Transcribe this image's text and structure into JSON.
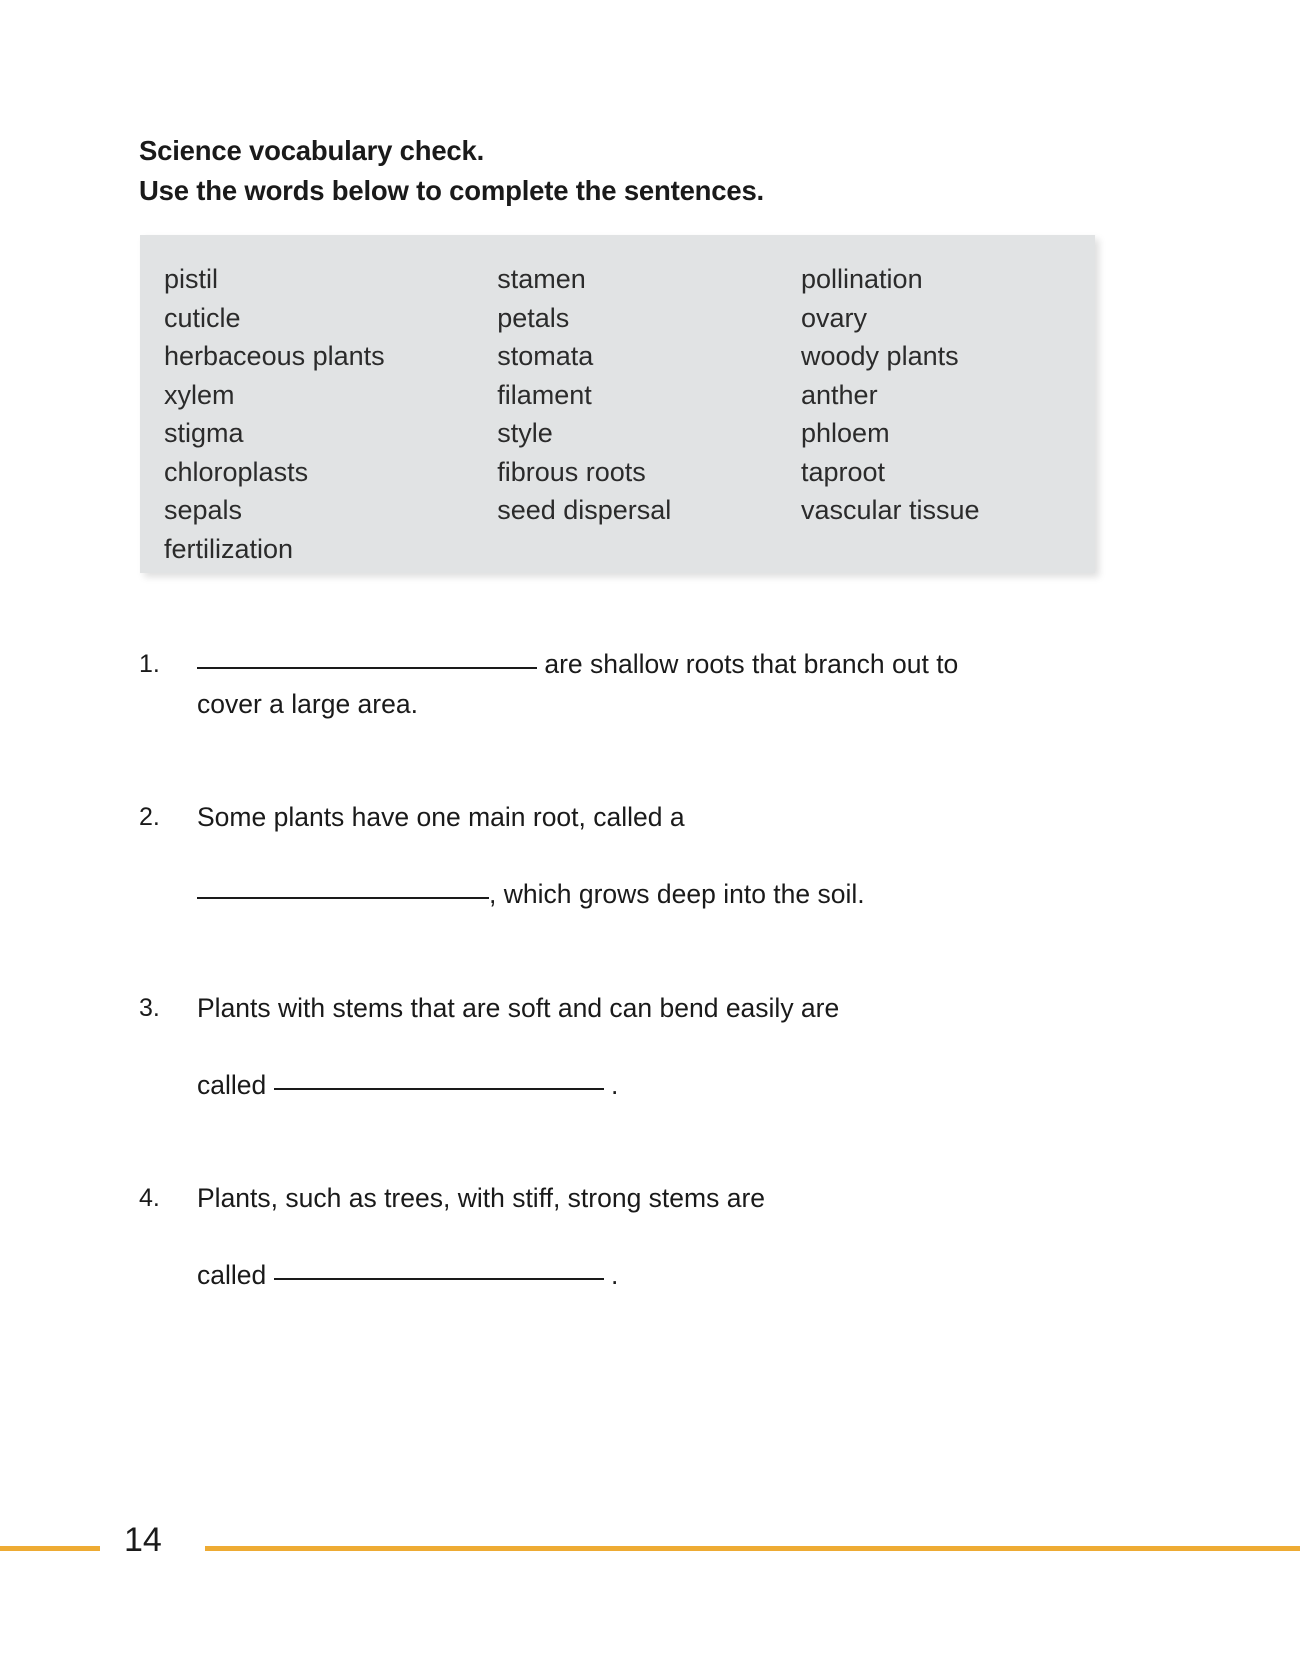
{
  "heading": {
    "line1": "Science vocabulary check.",
    "line2": "Use the words below to complete the sentences."
  },
  "word_bank": {
    "column1": [
      "pistil",
      "cuticle",
      "herbaceous plants",
      "xylem",
      "stigma",
      "chloroplasts",
      "sepals",
      "fertilization"
    ],
    "column2": [
      "stamen",
      "petals",
      "stomata",
      "filament",
      "style",
      "fibrous roots",
      "seed dispersal"
    ],
    "column3": [
      "pollination",
      "ovary",
      "woody plants",
      "anther",
      "phloem",
      "taproot",
      "vascular tissue"
    ],
    "background_color": "#e1e3e4"
  },
  "questions": [
    {
      "number": "1.",
      "line1_before_blank": "",
      "line1_after_blank": " are shallow roots that branch out to",
      "line2": "cover a large area."
    },
    {
      "number": "2.",
      "line1": "Some plants have one main root, called a",
      "line2_before_blank": "",
      "line2_after_blank": ", which grows deep into the soil."
    },
    {
      "number": "3.",
      "line1": "Plants with stems that are soft and can bend easily are",
      "line2_before_blank": "called ",
      "line2_after_blank": " ."
    },
    {
      "number": "4.",
      "line1": "Plants, such as trees, with stiff, strong stems are",
      "line2_before_blank": "called ",
      "line2_after_blank": " ."
    }
  ],
  "footer": {
    "page_number": "14",
    "rule_color": "#eeab33"
  }
}
